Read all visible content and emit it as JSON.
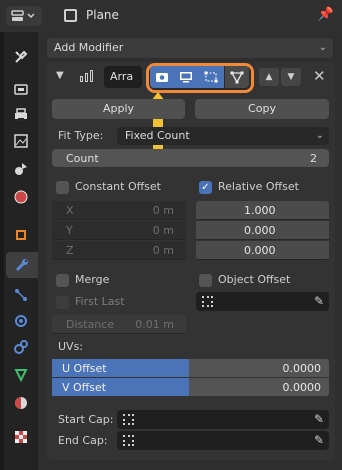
{
  "header": {
    "title": "Plane",
    "editor_icon": "properties-editor-icon",
    "pin_icon": "pin-icon"
  },
  "left_tabs": [
    {
      "name": "tool-tab",
      "icon": "wrench-screwdriver-icon",
      "active": false
    },
    {
      "name": "render-tab",
      "icon": "camera-back-icon",
      "active": false
    },
    {
      "name": "output-tab",
      "icon": "printer-icon",
      "active": false
    },
    {
      "name": "view-layer-tab",
      "icon": "image-icon",
      "active": false
    },
    {
      "name": "scene-tab",
      "icon": "scene-icon",
      "active": false
    },
    {
      "name": "world-tab",
      "icon": "globe-icon",
      "active": false
    },
    {
      "name": "object-tab",
      "icon": "object-square-icon",
      "active": false
    },
    {
      "name": "modifier-tab",
      "icon": "wrench-icon",
      "active": true
    },
    {
      "name": "particles-tab",
      "icon": "particles-icon",
      "active": false
    },
    {
      "name": "physics-tab",
      "icon": "orbit-icon",
      "active": false
    },
    {
      "name": "constraints-tab",
      "icon": "constraint-icon",
      "active": false
    },
    {
      "name": "data-tab",
      "icon": "triangle-vertex-icon",
      "active": false
    },
    {
      "name": "material-tab",
      "icon": "material-sphere-icon",
      "active": false
    },
    {
      "name": "texture-tab",
      "icon": "checker-icon",
      "active": false
    }
  ],
  "add_modifier": {
    "label": "Add Modifier"
  },
  "modifier": {
    "name": "Arra",
    "toggles": [
      "camera-icon",
      "monitor-icon",
      "editmode-vertices-icon",
      "cage-vertex-icon"
    ],
    "apply_label": "Apply",
    "copy_label": "Copy",
    "fit_type_label": "Fit Type:",
    "fit_type_value": "Fixed Count",
    "count_label": "Count",
    "count_value": "2",
    "constant_offset": {
      "label": "Constant Offset",
      "checked": false,
      "x_label": "X",
      "y_label": "Y",
      "z_label": "Z",
      "x": "0 m",
      "y": "0 m",
      "z": "0 m"
    },
    "relative_offset": {
      "label": "Relative Offset",
      "checked": true,
      "x": "1.000",
      "y": "0.000",
      "z": "0.000"
    },
    "merge_label": "Merge",
    "object_offset_label": "Object Offset",
    "first_last_label": "First Last",
    "distance_label": "Distance",
    "distance_value": "0.01 m",
    "uvs_label": "UVs:",
    "u_offset": {
      "label": "U Offset",
      "value": "0.0000"
    },
    "v_offset": {
      "label": "V Offset",
      "value": "0.0000"
    },
    "start_cap_label": "Start Cap:",
    "end_cap_label": "End Cap:"
  },
  "colors": {
    "accent_blue": "#4a73b8",
    "highlight_orange": "#f08a3a",
    "arrow_yellow": "#f1c232"
  }
}
